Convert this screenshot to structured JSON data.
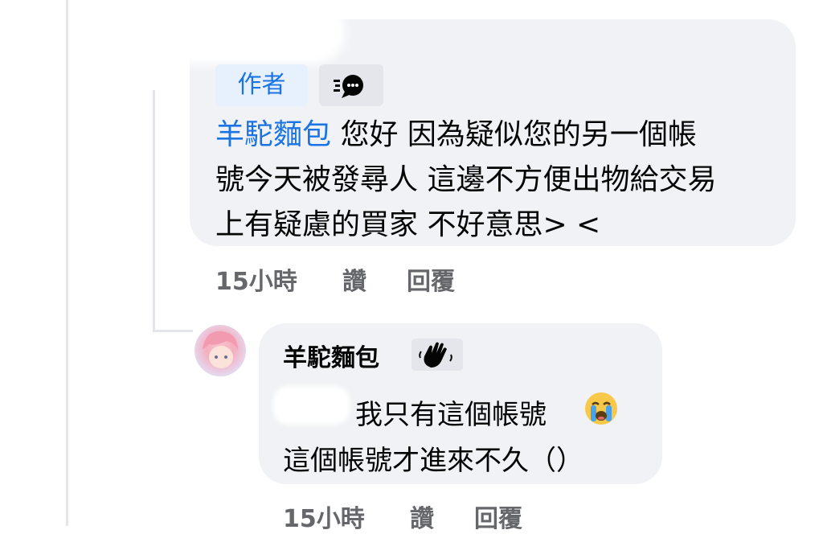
{
  "comment": {
    "author_badge": "作者",
    "mention": "羊駝麵包",
    "text_line1": " 您好 因為疑似您的另一個帳",
    "text_line2": "號今天被發尋人 這邊不方便出物給交易",
    "text_line3": "上有疑慮的買家 不好意思> <",
    "time": "15小時",
    "like": "讚",
    "reply": "回覆"
  },
  "reply": {
    "name": "羊駝麵包",
    "text_line1": "我只有這個帳號",
    "text_line2": "這個帳號才進來不久（）",
    "time": "15小時",
    "like": "讚",
    "reply": "回覆"
  },
  "colors": {
    "bubble": "#f0f2f5",
    "link_blue": "#1b74e4",
    "meta_gray": "#65676b",
    "badge_bg": "#e7f0fd"
  },
  "icons": {
    "chat_badge": "speech-bubble-icon",
    "wave": "waving-hand-icon",
    "crying": "crying-face-emoji"
  }
}
